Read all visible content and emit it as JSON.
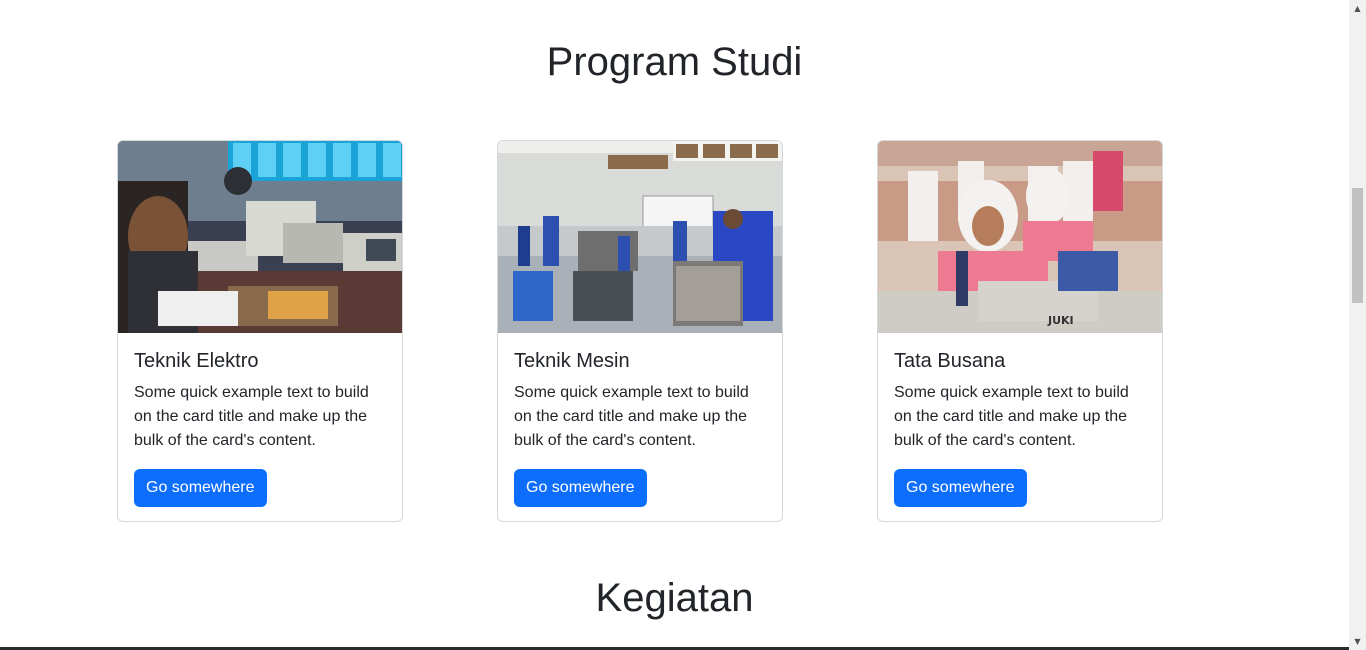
{
  "sections": {
    "program_studi": "Program Studi",
    "kegiatan": "Kegiatan"
  },
  "cards": [
    {
      "title": "Teknik Elektro",
      "text": "Some quick example text to build on the card title and make up the bulk of the card's content.",
      "button": "Go somewhere",
      "image_alt": "electronics-lab-photo"
    },
    {
      "title": "Teknik Mesin",
      "text": "Some quick example text to build on the card title and make up the bulk of the card's content.",
      "button": "Go somewhere",
      "image_alt": "engine-workshop-photo"
    },
    {
      "title": "Tata Busana",
      "text": "Some quick example text to build on the card title and make up the bulk of the card's content.",
      "button": "Go somewhere",
      "image_alt": "sewing-class-photo"
    }
  ],
  "colors": {
    "primary_button": "#0d6efd",
    "text": "#212529"
  }
}
